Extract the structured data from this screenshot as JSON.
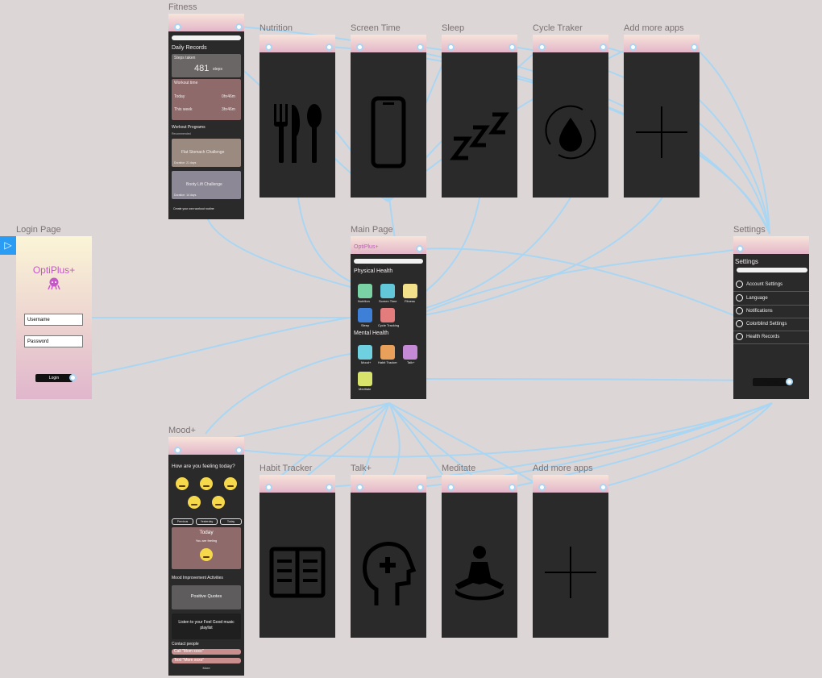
{
  "sidebar_toggle": "▷",
  "frames": {
    "fitness": "Fitness",
    "nutrition": "Nutrition",
    "screen_time": "Screen Time",
    "sleep": "Sleep",
    "cycle": "Cycle Traker",
    "add_apps_top": "Add more apps",
    "login": "Login Page",
    "main": "Main Page",
    "settings": "Settings",
    "mood": "Mood+",
    "habit": "Habit Tracker",
    "talk": "Talk+",
    "meditate": "Meditate",
    "add_apps_bottom": "Add more apps"
  },
  "fitness": {
    "daily_records": "Daily Records",
    "steps_taken": "Steps taken",
    "steps_value": "481",
    "steps_unit": "steps",
    "workout_time": "Workout time",
    "today": "Today",
    "today_value": "0hr46m",
    "this_week": "This week",
    "week_value": "3hr46m",
    "workout_programs": "Workout Programs",
    "recommended": "Recommended",
    "program1": "Flat Stomach Challenge",
    "program1_duration": "Duration: 21 days",
    "program2": "Booty Lift Challenge",
    "program2_duration": "Duration: 14 days",
    "create_routine": "Create your own workout routine"
  },
  "login": {
    "brand": "OptiPlus+",
    "username": "Username",
    "password": "Password",
    "login_button": "Login"
  },
  "main": {
    "brand": "OptiPlus+",
    "physical": "Physical Health",
    "mental": "Mental Health",
    "apps_physical": [
      "Nutrition",
      "Screen Time",
      "Fitness",
      "Sleep",
      "Cycle Tracking"
    ],
    "apps_mental": [
      "Mood+",
      "Habit Tracker",
      "Talk+",
      "Meditate"
    ]
  },
  "settings": {
    "title": "Settings",
    "items": [
      "Account Settings",
      "Language",
      "Notifications",
      "Colorblind Settings",
      "Health Records"
    ],
    "logout": "Sign out"
  },
  "mood": {
    "question": "How are you feeling today?",
    "tabs": [
      "Previous",
      "Yesterday",
      "Today"
    ],
    "today": "Today",
    "feeling": "You are feeling",
    "activities": "Mood Improvement Activities",
    "quotes": "Positive Quotes",
    "playlist": "Listen to your Feel Good music playlist",
    "contact_people": "Contact people",
    "call": "Call \"Mom xoxo\"",
    "text": "Text \"Mom xoxo\"",
    "more": "More"
  },
  "colors": {
    "canvas": "#ddd6d6",
    "screen": "#2b2a2a",
    "connector": "#a9d6f3",
    "brand": "#c557c9"
  }
}
